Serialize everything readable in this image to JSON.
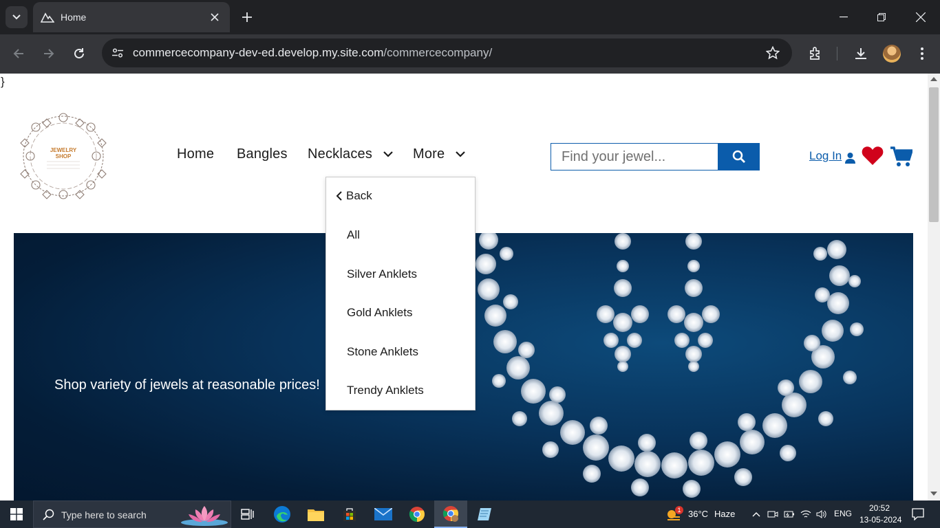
{
  "browser": {
    "tab_title": "Home",
    "url_host": "commercecompany-dev-ed.develop.my.site.com",
    "url_path": "/commercecompany/"
  },
  "page": {
    "stray_text": "}",
    "logo_text": "JEWELRY SHOP",
    "nav": {
      "home": "Home",
      "bangles": "Bangles",
      "necklaces": "Necklaces",
      "more": "More"
    },
    "search": {
      "placeholder": "Find your jewel..."
    },
    "login": "Log In",
    "hero_text": "Shop variety of jewels at reasonable prices!",
    "dropdown": {
      "back": "Back",
      "items": [
        "All",
        "Silver Anklets",
        "Gold Anklets",
        "Stone Anklets",
        "Trendy Anklets"
      ]
    }
  },
  "taskbar": {
    "search_placeholder": "Type here to search",
    "weather_temp": "36°C",
    "weather_desc": "Haze",
    "weather_badge": "1",
    "language": "ENG",
    "time": "20:52",
    "date": "13-05-2024"
  },
  "colors": {
    "accent": "#0b5cab",
    "heart": "#d0021b",
    "hero_bg": "#062a4d",
    "chrome_dark": "#202124",
    "chrome_toolbar": "#35363a"
  }
}
